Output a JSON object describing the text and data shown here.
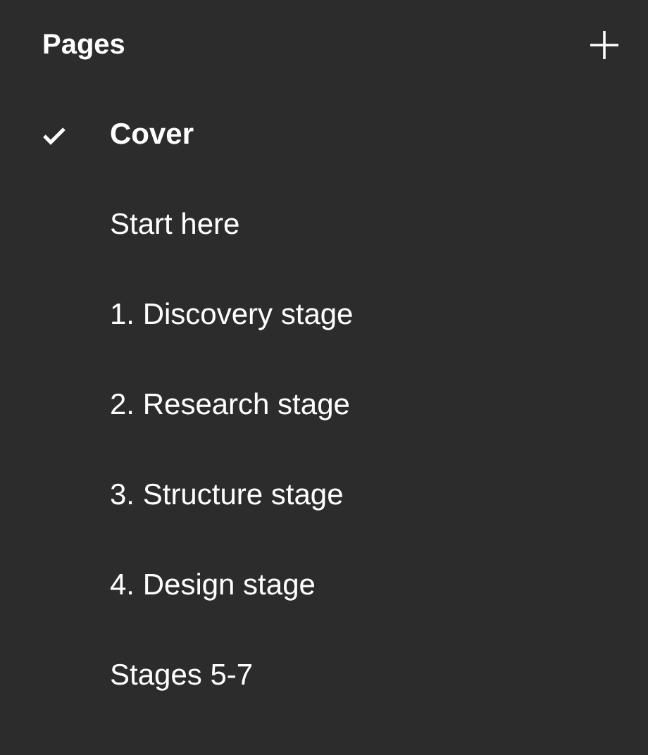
{
  "panel": {
    "title": "Pages"
  },
  "pages": [
    {
      "label": "Cover",
      "selected": true
    },
    {
      "label": "Start here",
      "selected": false
    },
    {
      "label": "1. Discovery stage",
      "selected": false
    },
    {
      "label": "2. Research stage",
      "selected": false
    },
    {
      "label": "3. Structure stage",
      "selected": false
    },
    {
      "label": "4. Design stage",
      "selected": false
    },
    {
      "label": "Stages 5-7",
      "selected": false
    }
  ]
}
